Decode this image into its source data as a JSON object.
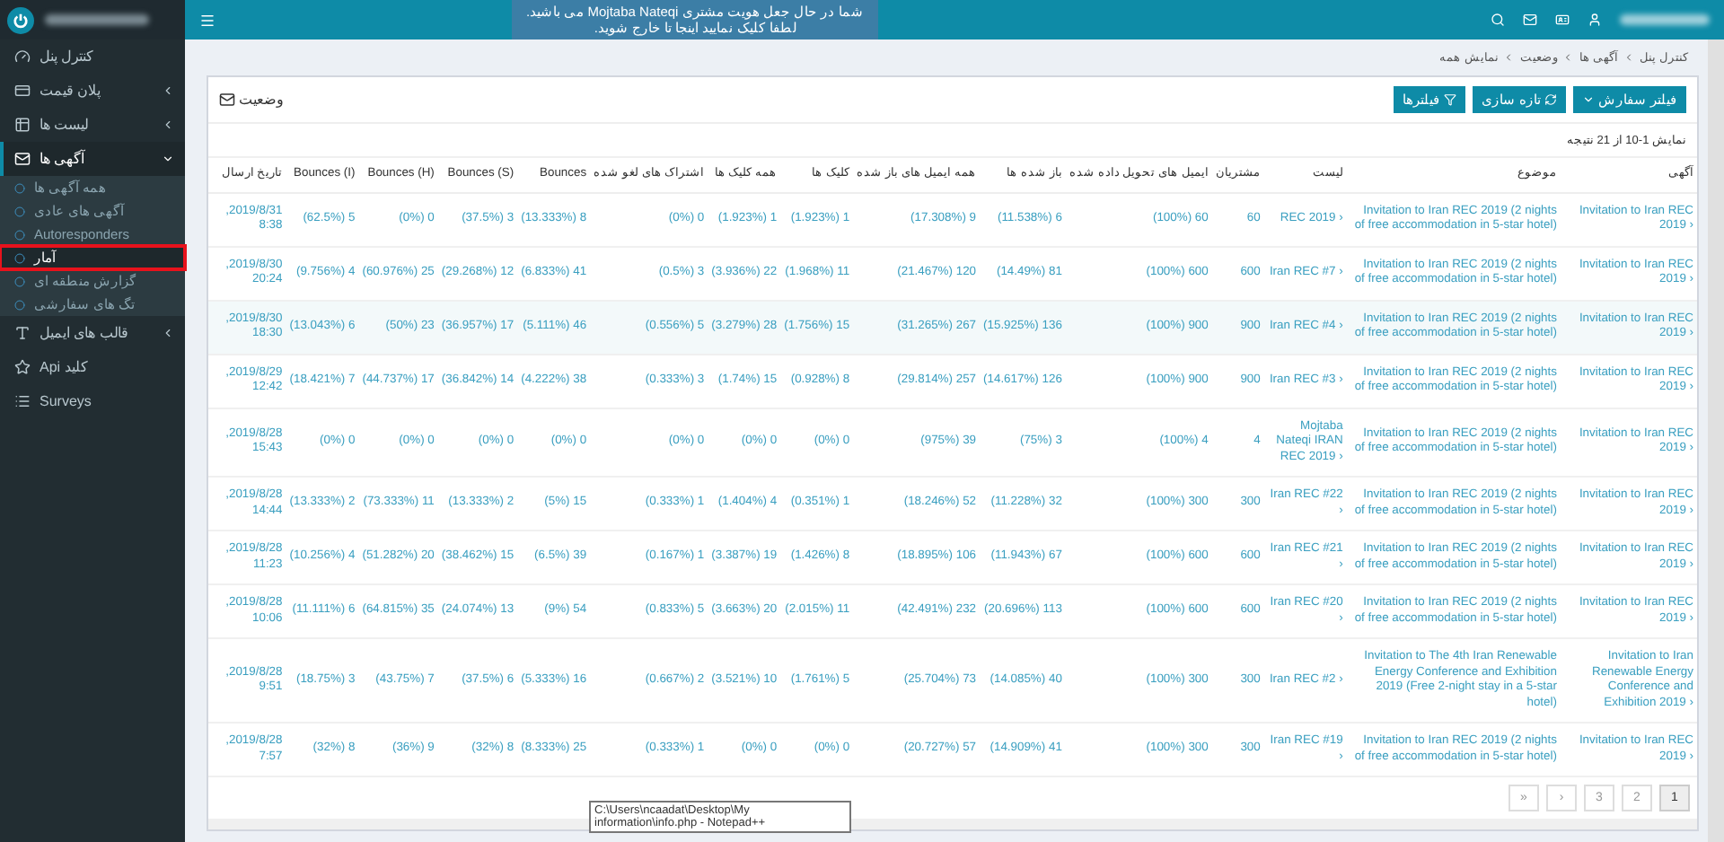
{
  "topbar": {
    "banner": [
      "شما در حال جعل هویت مشتری Mojtaba Nateqi می باشید.",
      "لطفا کلیک نمایید اینجا تا خارج شوید."
    ]
  },
  "sidebar": {
    "items": [
      {
        "label": "کنترل پنل",
        "selected": false
      },
      {
        "label": "پلان قیمت",
        "selected": false,
        "expanded": false
      },
      {
        "label": "لیست ها",
        "selected": false,
        "expanded": false
      },
      {
        "label": "آگهی ها",
        "selected": false,
        "expanded": true,
        "children": [
          {
            "label": "همه آگهی ها",
            "selected": false
          },
          {
            "label": "آگهی های عادی",
            "selected": false
          },
          {
            "label": "Autoresponders",
            "selected": false
          },
          {
            "label": "آمار",
            "selected": true
          },
          {
            "label": "گزارش منطقه ای",
            "selected": false
          },
          {
            "label": "تگ های سفارشی",
            "selected": false
          }
        ]
      },
      {
        "label": "قالب های ایمیل",
        "selected": false,
        "expanded": false
      },
      {
        "label": "Api کلید",
        "selected": false
      },
      {
        "label": "Surveys",
        "selected": false
      }
    ]
  },
  "breadcrumb": [
    "کنترل پنل",
    "آگهی ها",
    "وضعیت",
    "نمایش همه"
  ],
  "card": {
    "title": "وضعیت",
    "buttons": [
      {
        "label": "فیلتر سفارش",
        "kind": "dropdown"
      },
      {
        "label": "تازه سازی",
        "kind": "refresh"
      },
      {
        "label": "فیلترها",
        "kind": "filter"
      }
    ],
    "summary": "نمایش 1-10 از 21 نتیجه"
  },
  "table": {
    "columns": [
      "تاریخ ارسال",
      "Bounces (I)",
      "Bounces (H)",
      "Bounces (S)",
      "Bounces",
      "اشتراک های لغو شده",
      "همه کلیک ها",
      "کلیک ها",
      "همه ایمیل های باز شده",
      "باز شده ها",
      "ایمیل های تحویل داده شده",
      "مشتریان",
      "لیست",
      "موضوع",
      "آگهی"
    ],
    "rows": [
      {
        "highlighted": false,
        "cells": [
          "2019/8/31, 8:38",
          "5 (62.5%)",
          "0 (0%)",
          "3 (37.5%)",
          "8 (13.333%)",
          "0 (0%)",
          "1 (1.923%)",
          "1 (1.923%)",
          "9 (17.308%)",
          "6 (11.538%)",
          "60 (100%)",
          "60",
          "REC 2019 ›",
          "Invitation to Iran REC 2019 (2 nights of free accommodation in 5-star hotel)",
          "Invitation to Iran REC 2019 ›"
        ]
      },
      {
        "highlighted": false,
        "cells": [
          "2019/8/30, 20:24",
          "4 (9.756%)",
          "25 (60.976%)",
          "12 (29.268%)",
          "41 (6.833%)",
          "3 (0.5%)",
          "22 (3.936%)",
          "11 (1.968%)",
          "120 (21.467%)",
          "81 (14.49%)",
          "600 (100%)",
          "600",
          "Iran REC #7 ›",
          "Invitation to Iran REC 2019 (2 nights of free accommodation in 5-star hotel)",
          "Invitation to Iran REC 2019 ›"
        ]
      },
      {
        "highlighted": true,
        "cells": [
          "2019/8/30, 18:30",
          "6 (13.043%)",
          "23 (50%)",
          "17 (36.957%)",
          "46 (5.111%)",
          "5 (0.556%)",
          "28 (3.279%)",
          "15 (1.756%)",
          "267 (31.265%)",
          "136 (15.925%)",
          "900 (100%)",
          "900",
          "Iran REC #4 ›",
          "Invitation to Iran REC 2019 (2 nights of free accommodation in 5-star hotel)",
          "Invitation to Iran REC 2019 ›"
        ]
      },
      {
        "highlighted": false,
        "cells": [
          "2019/8/29, 12:42",
          "7 (18.421%)",
          "17 (44.737%)",
          "14 (36.842%)",
          "38 (4.222%)",
          "3 (0.333%)",
          "15 (1.74%)",
          "8 (0.928%)",
          "257 (29.814%)",
          "126 (14.617%)",
          "900 (100%)",
          "900",
          "Iran REC #3 ›",
          "Invitation to Iran REC 2019 (2 nights of free accommodation in 5-star hotel)",
          "Invitation to Iran REC 2019 ›"
        ]
      },
      {
        "highlighted": false,
        "cells": [
          "2019/8/28, 15:43",
          "0 (0%)",
          "0 (0%)",
          "0 (0%)",
          "0 (0%)",
          "0 (0%)",
          "0 (0%)",
          "0 (0%)",
          "39 (975%)",
          "3 (75%)",
          "4 (100%)",
          "4",
          "Mojtaba Nateqi IRAN REC 2019 ›",
          "Invitation to Iran REC 2019 (2 nights of free accommodation in 5-star hotel)",
          "Invitation to Iran REC 2019 ›"
        ]
      },
      {
        "highlighted": false,
        "cells": [
          "2019/8/28, 14:44",
          "2 (13.333%)",
          "11 (73.333%)",
          "2 (13.333%)",
          "15 (5%)",
          "1 (0.333%)",
          "4 (1.404%)",
          "1 (0.351%)",
          "52 (18.246%)",
          "32 (11.228%)",
          "300 (100%)",
          "300",
          "Iran REC #22 ›",
          "Invitation to Iran REC 2019 (2 nights of free accommodation in 5-star hotel)",
          "Invitation to Iran REC 2019 ›"
        ]
      },
      {
        "highlighted": false,
        "cells": [
          "2019/8/28, 11:23",
          "4 (10.256%)",
          "20 (51.282%)",
          "15 (38.462%)",
          "39 (6.5%)",
          "1 (0.167%)",
          "19 (3.387%)",
          "8 (1.426%)",
          "106 (18.895%)",
          "67 (11.943%)",
          "600 (100%)",
          "600",
          "Iran REC #21 ›",
          "Invitation to Iran REC 2019 (2 nights of free accommodation in 5-star hotel)",
          "Invitation to Iran REC 2019 ›"
        ]
      },
      {
        "highlighted": false,
        "cells": [
          "2019/8/28, 10:06",
          "6 (11.111%)",
          "35 (64.815%)",
          "13 (24.074%)",
          "54 (9%)",
          "5 (0.833%)",
          "20 (3.663%)",
          "11 (2.015%)",
          "232 (42.491%)",
          "113 (20.696%)",
          "600 (100%)",
          "600",
          "Iran REC #20 ›",
          "Invitation to Iran REC 2019 (2 nights of free accommodation in 5-star hotel)",
          "Invitation to Iran REC 2019 ›"
        ]
      },
      {
        "highlighted": false,
        "cells": [
          "2019/8/28, 9:51",
          "3 (18.75%)",
          "7 (43.75%)",
          "6 (37.5%)",
          "16 (5.333%)",
          "2 (0.667%)",
          "10 (3.521%)",
          "5 (1.761%)",
          "73 (25.704%)",
          "40 (14.085%)",
          "300 (100%)",
          "300",
          "Iran REC #2 ›",
          "Invitation to The 4th Iran Renewable Energy Conference and Exhibition 2019 (Free 2-night stay in a 5-star hotel)",
          "Invitation to Iran Renewable Energy Conference and Exhibition 2019 ›"
        ]
      },
      {
        "highlighted": false,
        "cells": [
          "2019/8/28, 7:57",
          "8 (32%)",
          "9 (36%)",
          "8 (32%)",
          "25 (8.333%)",
          "1 (0.333%)",
          "0 (0%)",
          "0 (0%)",
          "57 (20.727%)",
          "41 (14.909%)",
          "300 (100%)",
          "300",
          "Iran REC #19 ›",
          "Invitation to Iran REC 2019 (2 nights of free accommodation in 5-star hotel)",
          "Invitation to Iran REC 2019 ›"
        ]
      }
    ]
  },
  "pagination": [
    {
      "label": "»",
      "selected": false
    },
    {
      "label": "›",
      "selected": false
    },
    {
      "label": "3",
      "selected": false
    },
    {
      "label": "2",
      "selected": false
    },
    {
      "label": "1",
      "selected": true
    }
  ],
  "tooltip": "C:\\Users\\ncaadat\\Desktop\\My information\\info.php - Notepad++"
}
